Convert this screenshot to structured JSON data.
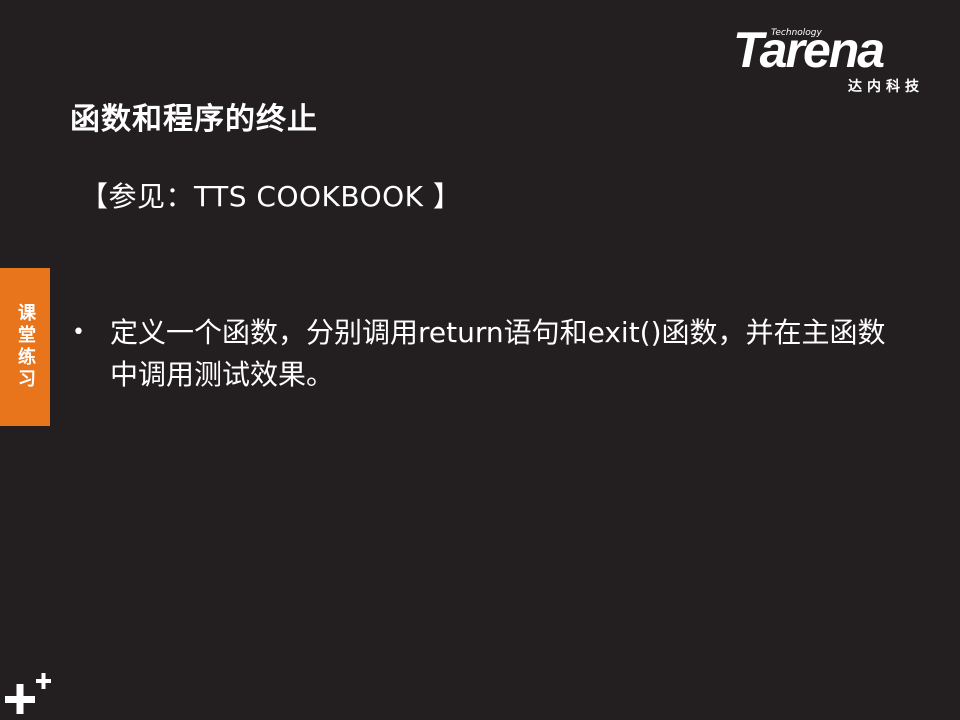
{
  "brand": {
    "tagline": "Technology",
    "name": "Tarena",
    "chinese": "达内科技"
  },
  "slide": {
    "title": "函数和程序的终止",
    "reference": "【参见：TTS COOKBOOK 】",
    "side_tab": "课堂练习",
    "bullet_symbol": "•",
    "bullets": [
      "定义一个函数，分别调用return语句和exit()函数，并在主函数中调用测试效果。"
    ]
  },
  "colors": {
    "background": "#231f20",
    "accent": "#e8741c",
    "text": "#ffffff"
  },
  "icons": [
    "plus-icon"
  ]
}
